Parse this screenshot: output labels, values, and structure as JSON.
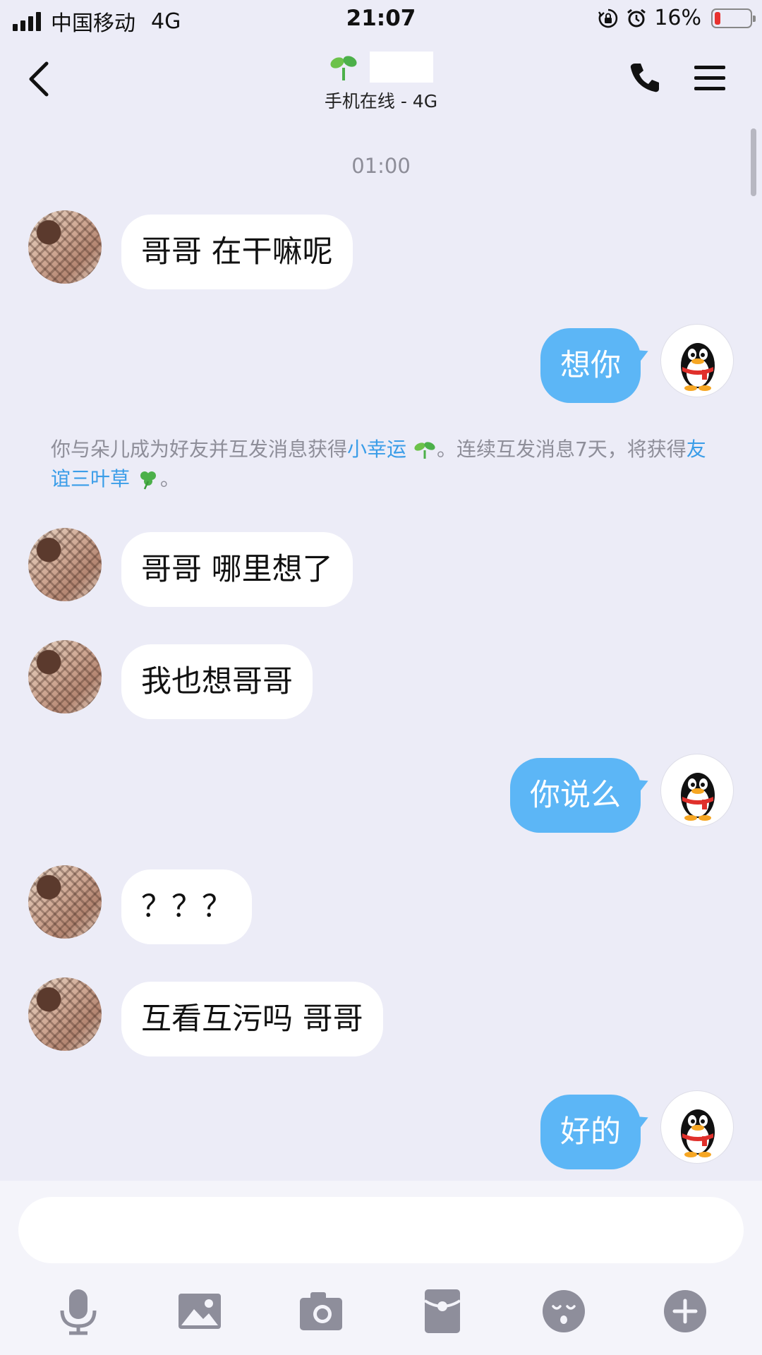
{
  "status_bar": {
    "carrier": "中国移动",
    "network": "4G",
    "time": "21:07",
    "battery_percent": "16%",
    "battery_level": 0.16,
    "icons": [
      "signal-icon",
      "rotation-lock-icon",
      "alarm-icon",
      "battery-icon"
    ]
  },
  "header": {
    "contact_name": "",
    "status": "手机在线 - 4G",
    "icons": [
      "back-icon",
      "sprout-icon",
      "phone-icon",
      "menu-icon"
    ]
  },
  "chat": {
    "time_divider": "01:00",
    "messages": [
      {
        "from": "contact",
        "text": "哥哥 在干嘛呢"
      },
      {
        "from": "me",
        "text": "想你"
      },
      {
        "from": "contact",
        "text": "哥哥 哪里想了"
      },
      {
        "from": "contact",
        "text": "我也想哥哥"
      },
      {
        "from": "me",
        "text": "你说么"
      },
      {
        "from": "contact",
        "text": "？？？"
      },
      {
        "from": "contact",
        "text": "互看互污吗 哥哥"
      },
      {
        "from": "me",
        "text": "好的"
      }
    ],
    "system_note": {
      "part1": "你与朵儿成为好友并互发消息获得",
      "link1": "小幸运",
      "part2": "。连续互发消息7天，将获得",
      "link2": "友谊三叶草",
      "part3": "。"
    }
  },
  "input": {
    "value": "",
    "placeholder": ""
  },
  "toolbar": {
    "icons": [
      "microphone-icon",
      "image-icon",
      "camera-icon",
      "red-packet-icon",
      "emoji-icon",
      "plus-icon"
    ]
  },
  "colors": {
    "background": "#ececf7",
    "outgoing_bubble": "#5cb6f6",
    "incoming_bubble": "#ffffff",
    "link": "#3a9de8",
    "battery_low": "#e8322f"
  }
}
